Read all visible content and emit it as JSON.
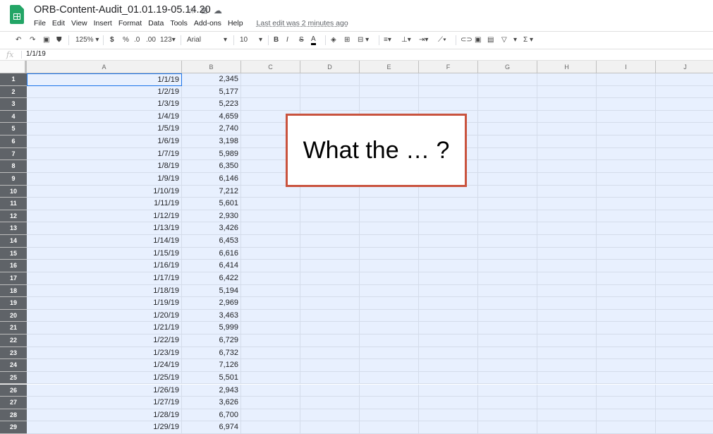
{
  "app": {
    "doc_title": "ORB-Content-Audit_01.01.19-05.14.20",
    "title_icons": [
      "star-icon",
      "move-to-folder-icon",
      "cloud-status-icon"
    ],
    "menus": [
      "File",
      "Edit",
      "View",
      "Insert",
      "Format",
      "Data",
      "Tools",
      "Add-ons",
      "Help"
    ],
    "last_edit": "Last edit was 2 minutes ago"
  },
  "toolbar": {
    "zoom": "125%",
    "currency": "$",
    "percent": "%",
    "decrease_decimal": ".0",
    "increase_decimal": ".00",
    "more_formats": "123",
    "font": "Arial",
    "font_size": "10",
    "bold": "B",
    "italic": "I",
    "strikethrough": "S",
    "text_color": "A",
    "sum": "Σ"
  },
  "formula_bar": {
    "fx": "fx",
    "value": "1/1/19"
  },
  "columns": [
    "A",
    "B",
    "C",
    "D",
    "E",
    "F",
    "G",
    "H",
    "I",
    "J"
  ],
  "rows": [
    {
      "n": "1",
      "a": "1/1/19",
      "b": "2,345"
    },
    {
      "n": "2",
      "a": "1/2/19",
      "b": "5,177"
    },
    {
      "n": "3",
      "a": "1/3/19",
      "b": "5,223"
    },
    {
      "n": "4",
      "a": "1/4/19",
      "b": "4,659"
    },
    {
      "n": "5",
      "a": "1/5/19",
      "b": "2,740"
    },
    {
      "n": "6",
      "a": "1/6/19",
      "b": "3,198"
    },
    {
      "n": "7",
      "a": "1/7/19",
      "b": "5,989"
    },
    {
      "n": "8",
      "a": "1/8/19",
      "b": "6,350"
    },
    {
      "n": "9",
      "a": "1/9/19",
      "b": "6,146"
    },
    {
      "n": "10",
      "a": "1/10/19",
      "b": "7,212"
    },
    {
      "n": "11",
      "a": "1/11/19",
      "b": "5,601"
    },
    {
      "n": "12",
      "a": "1/12/19",
      "b": "2,930"
    },
    {
      "n": "13",
      "a": "1/13/19",
      "b": "3,426"
    },
    {
      "n": "14",
      "a": "1/14/19",
      "b": "6,453"
    },
    {
      "n": "15",
      "a": "1/15/19",
      "b": "6,616"
    },
    {
      "n": "16",
      "a": "1/16/19",
      "b": "6,414"
    },
    {
      "n": "17",
      "a": "1/17/19",
      "b": "6,422"
    },
    {
      "n": "18",
      "a": "1/18/19",
      "b": "5,194"
    },
    {
      "n": "19",
      "a": "1/19/19",
      "b": "2,969"
    },
    {
      "n": "20",
      "a": "1/20/19",
      "b": "3,463"
    },
    {
      "n": "21",
      "a": "1/21/19",
      "b": "5,999"
    },
    {
      "n": "22",
      "a": "1/22/19",
      "b": "6,729"
    },
    {
      "n": "23",
      "a": "1/23/19",
      "b": "6,732"
    },
    {
      "n": "24",
      "a": "1/24/19",
      "b": "7,126"
    },
    {
      "n": "25",
      "a": "1/25/19",
      "b": "5,501"
    },
    {
      "n": "26",
      "a": "1/26/19",
      "b": "2,943"
    },
    {
      "n": "27",
      "a": "1/27/19",
      "b": "3,626"
    },
    {
      "n": "28",
      "a": "1/28/19",
      "b": "6,700"
    },
    {
      "n": "29",
      "a": "1/29/19",
      "b": "6,974"
    }
  ],
  "callout": {
    "text": "What the … ?",
    "border_color": "#c9533e"
  }
}
